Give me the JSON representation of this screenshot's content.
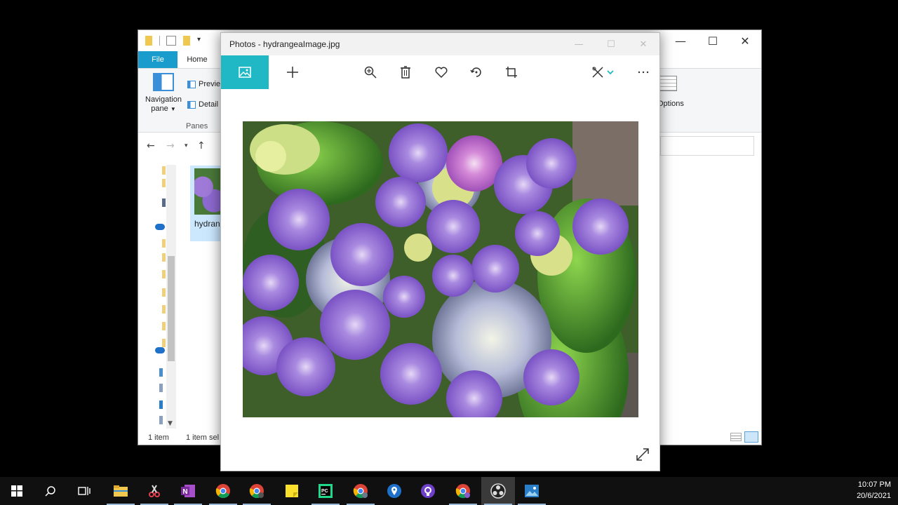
{
  "explorer": {
    "ribbon": {
      "tab_file": "File",
      "tab_home": "Home",
      "navpane_line1": "Navigation",
      "navpane_line2": "pane",
      "preview_label": "Previe",
      "details_label": "Detail",
      "panes_group": "Panes",
      "options_label": "Options"
    },
    "file_label": "hydran",
    "status": {
      "count": "1 item",
      "selected": "1 item sel"
    }
  },
  "photos": {
    "title": "Photos - hydrangeaImage.jpg",
    "accent": "#1fb8c4",
    "toolbar": [
      "photo-icon",
      "add-icon",
      "zoom-icon",
      "delete-icon",
      "favorite-icon",
      "rotate-icon",
      "crop-icon",
      "edit-icon",
      "more-icon"
    ]
  },
  "taskbar": {
    "apps": [
      "file-explorer",
      "snipping-tool",
      "onenote",
      "chrome",
      "chrome-profile",
      "sticky-notes",
      "pycharm",
      "chrome-profile-2",
      "maps",
      "github-desktop",
      "chrome-profile-3",
      "obs",
      "photos"
    ],
    "time": "10:07 PM",
    "date": "20/6/2021"
  }
}
